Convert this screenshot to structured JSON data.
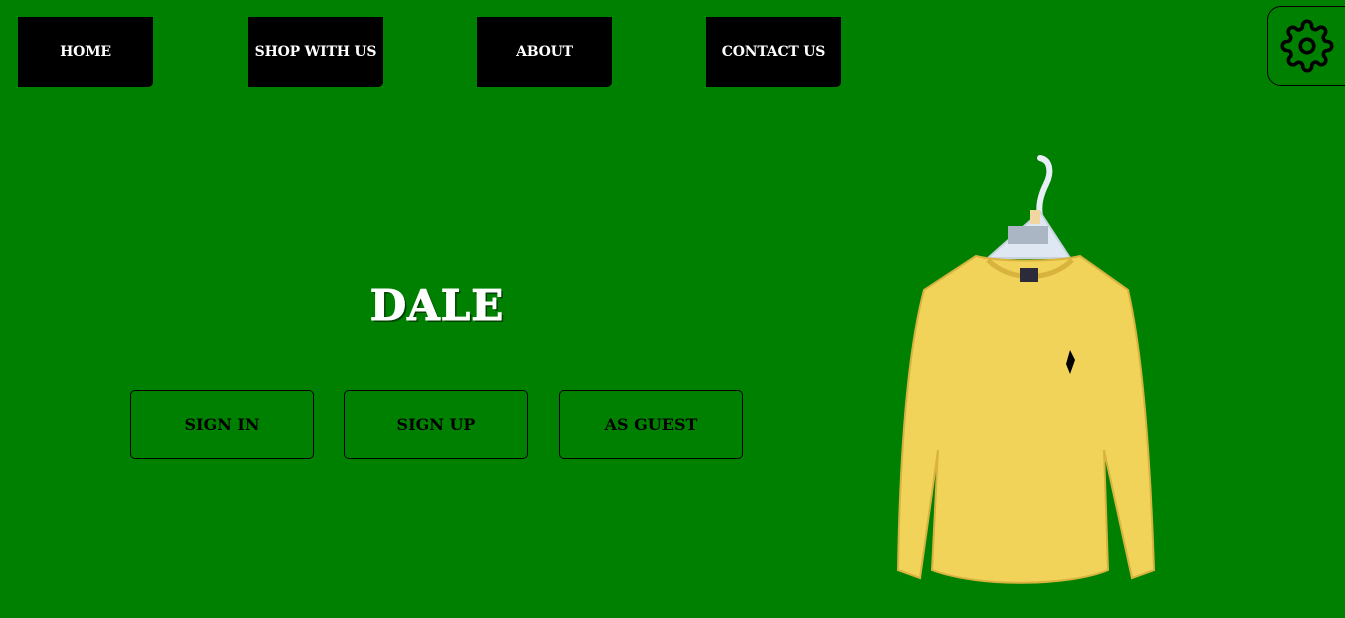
{
  "nav": {
    "items": [
      {
        "label": "HOME"
      },
      {
        "label": "SHOP WITH US"
      },
      {
        "label": "ABOUT"
      },
      {
        "label": "CONTACT US"
      }
    ]
  },
  "settings": {
    "icon": "gear-icon"
  },
  "hero": {
    "brand": "DALE",
    "buttons": {
      "sign_in": "SIGN IN",
      "sign_up": "SIGN UP",
      "guest": "AS GUEST"
    }
  },
  "product_image": {
    "subject": "yellow long-sleeve shirt on hanger"
  },
  "colors": {
    "background": "#008000",
    "nav_bg": "#000000",
    "nav_text": "#ffffff",
    "shirt": "#f2d35a"
  }
}
